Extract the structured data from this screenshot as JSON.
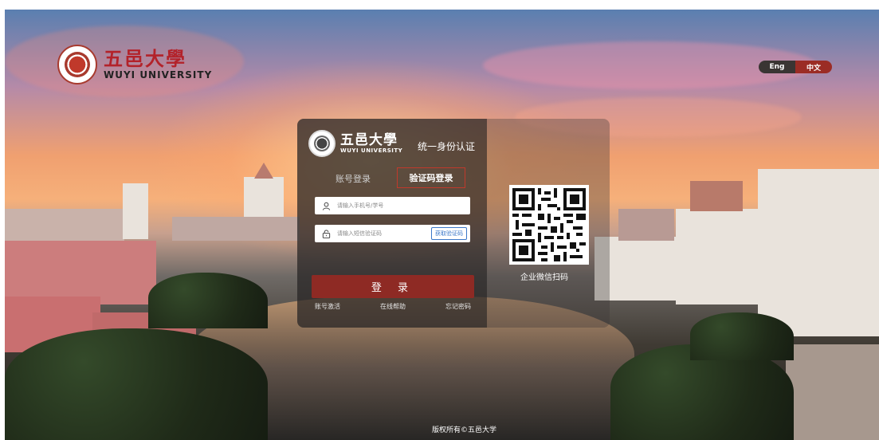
{
  "header": {
    "logo_cn": "五邑大學",
    "logo_en": "WUYI UNIVERSITY",
    "lang_en": "Eng",
    "lang_zh": "中文"
  },
  "card": {
    "logo_cn": "五邑大學",
    "logo_en": "WUYI UNIVERSITY",
    "title": "统一身份认证",
    "tabs": {
      "account": "账号登录",
      "code": "验证码登录"
    },
    "phone_placeholder": "请输入手机号/学号",
    "code_placeholder": "请输入短信验证码",
    "get_code_label": "获取验证码",
    "login_label": "登 录",
    "links": {
      "activate": "账号激活",
      "help": "在线帮助",
      "forgot": "忘记密码"
    },
    "qr_caption": "企业微信扫码"
  },
  "footer": {
    "copyright": "版权所有©五邑大学"
  },
  "colors": {
    "brand_red": "#8e2a24",
    "highlight_border": "#c0392b",
    "link_blue": "#3b78c9"
  }
}
